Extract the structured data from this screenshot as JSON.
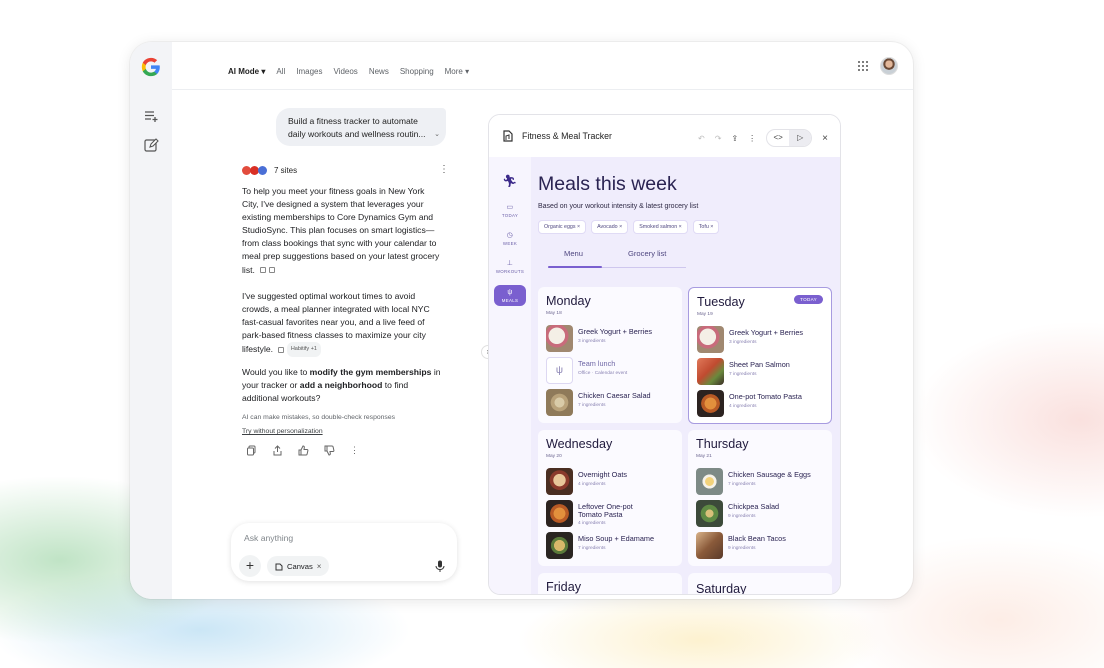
{
  "nav": {
    "ai_mode": "AI Mode",
    "all": "All",
    "images": "Images",
    "videos": "Videos",
    "news": "News",
    "shopping": "Shopping",
    "more": "More"
  },
  "chat": {
    "user_prompt": "Build a fitness tracker to automate daily workouts and wellness routin...",
    "sources_label": "7 sites",
    "paragraph1": "To help you meet your fitness goals in New York City, I've designed a system that leverages your existing memberships to Core Dynamics Gym and StudioSync. This plan focuses on smart logistics—from class bookings that sync with your calendar to meal prep suggestions based on your latest grocery list.",
    "paragraph2": "I've suggested optimal workout times to avoid crowds, a meal planner integrated with local NYC fast-casual favorites near you, and a live feed of park-based fitness classes to maximize your city lifestyle.",
    "habitify_chip": "Habitify +1",
    "q_pre": "Would you like to ",
    "q_b1": "modify the gym memberships",
    "q_mid": " in your tracker or ",
    "q_b2": "add a neighborhood",
    "q_post": " to find additional workouts?",
    "disclaimer": "AI can make mistakes, so double-check responses",
    "try_link": "Try without personalization"
  },
  "input": {
    "placeholder": "Ask anything",
    "canvas_chip": "Canvas"
  },
  "canvas": {
    "title": "Fitness & Meal Tracker"
  },
  "app": {
    "nav": {
      "today": "TODAY",
      "week": "WEEK",
      "workouts": "WORKOUTS",
      "meals": "MEALS"
    },
    "title": "Meals this week",
    "subtitle": "Based on your workout intensity & latest grocery list",
    "tags": [
      "Organic eggs",
      "Avocado",
      "Smoked salmon",
      "Tofu"
    ],
    "tabs": {
      "menu": "Menu",
      "grocery": "Grocery list"
    },
    "today_badge": "TODAY",
    "days": {
      "monday": {
        "name": "Monday",
        "date": "May 18",
        "meals": [
          {
            "name": "Greek Yogurt + Berries",
            "sub": "3 ingredients"
          },
          {
            "name": "Team lunch",
            "sub": "Office · Calendar event"
          },
          {
            "name": "Chicken Caesar Salad",
            "sub": "7 ingredients"
          }
        ]
      },
      "tuesday": {
        "name": "Tuesday",
        "date": "May 19",
        "meals": [
          {
            "name": "Greek Yogurt + Berries",
            "sub": "3 ingredients"
          },
          {
            "name": "Sheet Pan Salmon",
            "sub": "7 ingredients"
          },
          {
            "name": "One-pot Tomato Pasta",
            "sub": "4 ingredients"
          }
        ]
      },
      "wednesday": {
        "name": "Wednesday",
        "date": "May 20",
        "meals": [
          {
            "name": "Overnight Oats",
            "sub": "4 ingredients"
          },
          {
            "name": "Leftover One-pot Tomato Pasta",
            "sub": "4 ingredients"
          },
          {
            "name": "Miso Soup + Edamame",
            "sub": "7 ingredients"
          }
        ]
      },
      "thursday": {
        "name": "Thursday",
        "date": "May 21",
        "meals": [
          {
            "name": "Chicken Sausage & Eggs",
            "sub": "7 ingredients"
          },
          {
            "name": "Chickpea Salad",
            "sub": "9 ingredients"
          },
          {
            "name": "Black Bean Tacos",
            "sub": "9 ingredients"
          }
        ]
      },
      "friday": {
        "name": "Friday"
      },
      "saturday": {
        "name": "Saturday"
      }
    }
  },
  "colors": {
    "accent": "#7a5fcf",
    "app_bg": "#f0edfc",
    "title": "#2a2352"
  }
}
